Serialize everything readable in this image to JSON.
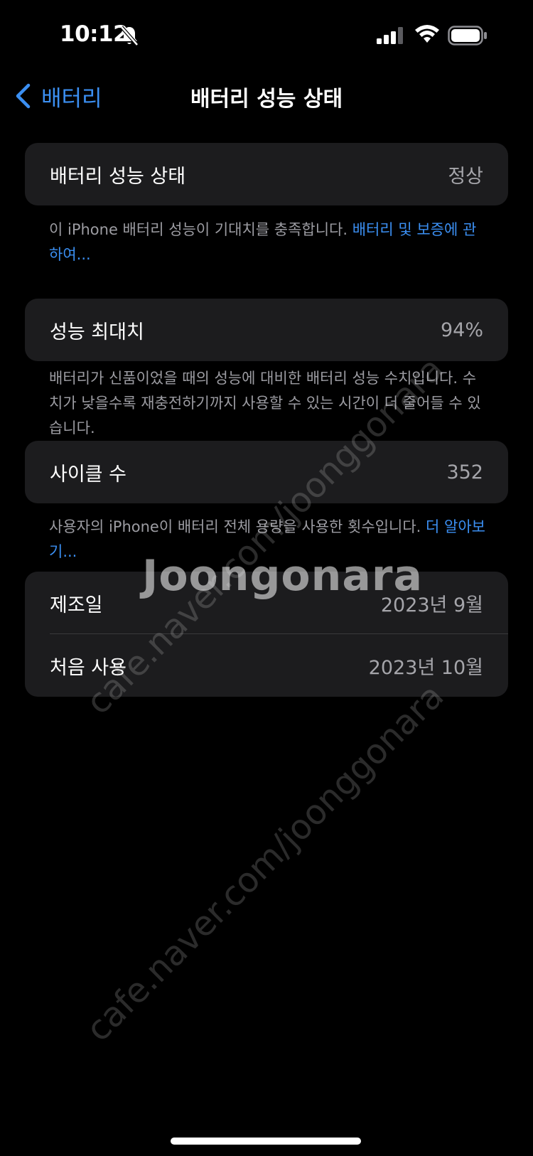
{
  "status_bar": {
    "time": "10:12"
  },
  "nav": {
    "back_label": "배터리",
    "title": "배터리 성능 상태"
  },
  "health_card": {
    "label": "배터리 성능 상태",
    "value": "정상"
  },
  "health_note": {
    "text": "이 iPhone 배터리 성능이 기대치를 충족합니다. ",
    "link": "배터리 및 보증에 관하여..."
  },
  "capacity_card": {
    "label": "성능 최대치",
    "value": "94%"
  },
  "capacity_note": {
    "text": "배터리가 신품이었을 때의 성능에 대비한 배터리 성능 수치입니다. 수치가 낮을수록 재충전하기까지 사용할 수 있는 시간이 더 줄어들 수 있습니다."
  },
  "cycle_card": {
    "label": "사이클 수",
    "value": "352"
  },
  "cycle_note": {
    "text": "사용자의 iPhone이 배터리 전체 용량을 사용한 횟수입니다. ",
    "link": "더 알아보기..."
  },
  "dates_card": {
    "manufacture_label": "제조일",
    "manufacture_value": "2023년 9월",
    "first_use_label": "처음 사용",
    "first_use_value": "2023년 10월"
  },
  "watermark": {
    "brand": "Joongonara",
    "site": "cafe.naver.com/joonggonara"
  },
  "colors": {
    "background": "#000000",
    "card": "#1c1c1e",
    "accent": "#3b8ff2",
    "secondary_text": "#a5a5aa"
  }
}
